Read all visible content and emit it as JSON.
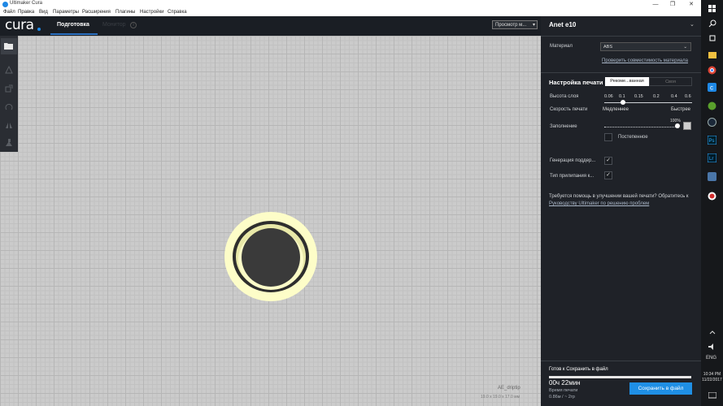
{
  "window": {
    "title": "Ultimaker Cura",
    "minimize_glyph": "—",
    "maximize_glyph": "❐",
    "close_glyph": "✕"
  },
  "menu": [
    "Файл",
    "Правка",
    "Вид",
    "Параметры",
    "Расширения",
    "Плагины",
    "Настройки",
    "Справка"
  ],
  "header": {
    "brand": "cura",
    "tab_prepare": "Подготовка",
    "tab_monitor": "Монитор",
    "view_mode": "Просмотр м...",
    "view_arrow": "▾"
  },
  "toolbar": {
    "icons": [
      "open-file-icon",
      "move-icon",
      "scale-icon",
      "rotate-icon",
      "mirror-icon",
      "per-model-settings-icon",
      "support-blocker-icon"
    ]
  },
  "model": {
    "name": "AE_driptip",
    "dimensions": "19.0 x 19.0 x 17.0 мм",
    "color": "#fdfdc8"
  },
  "panel": {
    "printer": "Anet e10",
    "printer_chevron": "⌄",
    "material_label": "Материал",
    "material_value": "ABS",
    "material_arrow": "⌄",
    "check_compat": "Проверить совместимость материала",
    "print_setup": "Настройка печати",
    "tab_recommended": "Рекоме...ванная",
    "tab_custom": "Своя",
    "layer_height_label": "Высота слоя",
    "layer_ticks": [
      "0.06",
      "0.1",
      "0.15",
      "0.2",
      "0.4",
      "0.6"
    ],
    "selected_layer_height": "0.1",
    "print_speed_label": "Скорость печати",
    "speed_slow": "Медленнее",
    "speed_fast": "Быстрее",
    "infill_label": "Заполнение",
    "infill_percent": "100%",
    "infill_value": 1.0,
    "gradual_label": "Постепенное",
    "gradual_checked": false,
    "support_label": "Генерация поддер...",
    "support_checked": true,
    "adhesion_label": "Тип прилипания к...",
    "adhesion_checked": true,
    "check_mark": "✓",
    "help_text": "Требуется помощь в улучшении вашей печати? Обратитесь к ",
    "help_link": "Руководству Ultimaker по решению проблем",
    "status": "Готов к Сохранить в файл",
    "progress": 1.0,
    "time": "00ч 22мин",
    "time_label": "Время печати",
    "material_usage": "0.86м / ~ 2гр",
    "save_button": "Сохранить в файл"
  },
  "taskbar": {
    "lang": "ENG",
    "time": "10:34 PM",
    "date": "11/22/2017"
  },
  "colors": {
    "accent": "#1f8fe5",
    "panel_bg": "#1f2228",
    "viewport_bg": "#cbcbcb"
  }
}
